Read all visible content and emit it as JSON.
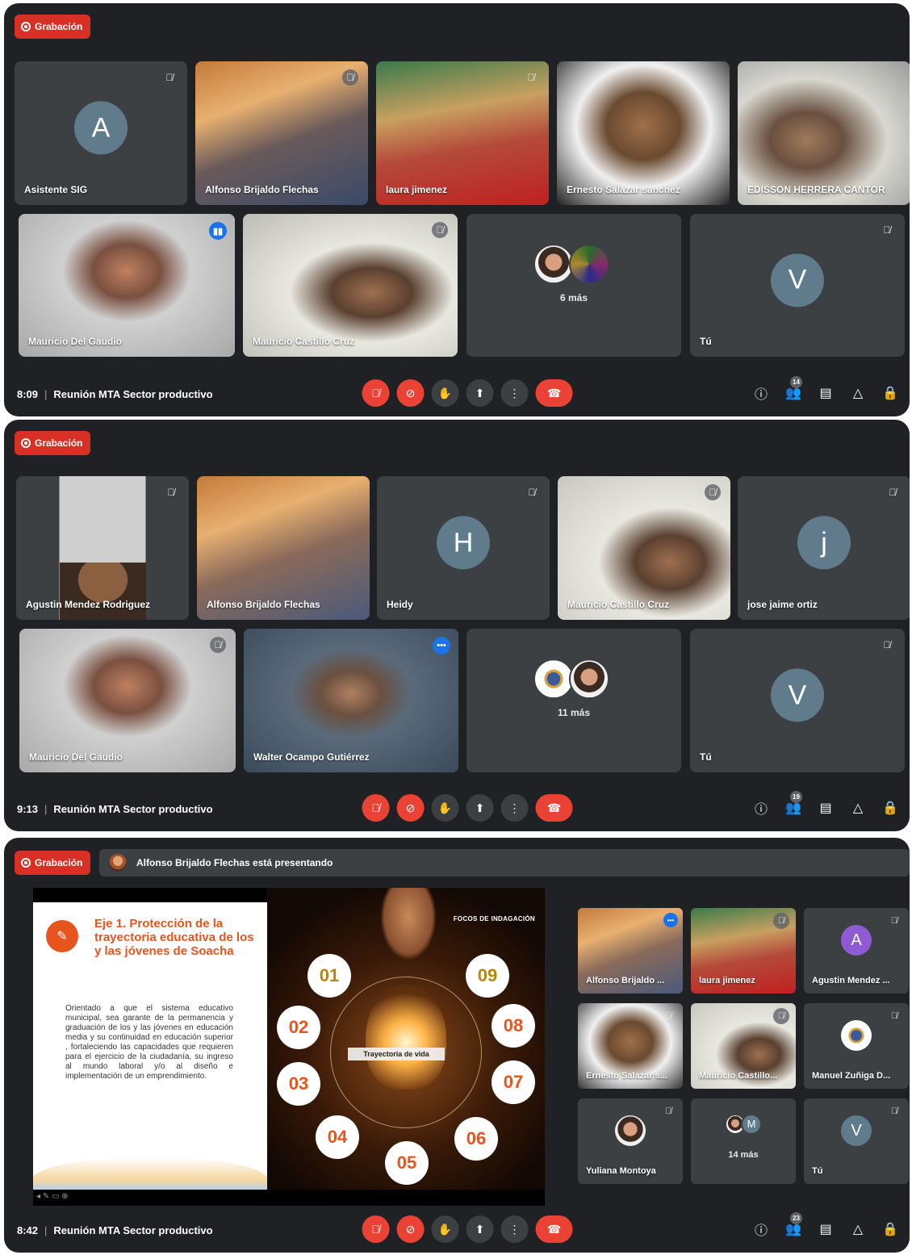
{
  "recording_label": "Grabación",
  "screens": [
    {
      "time": "8:09",
      "meeting_title": "Reunión MTA Sector productivo",
      "participant_count": "14",
      "tiles": [
        {
          "name": "Asistente SIG",
          "avatar": "A"
        },
        {
          "name": "Alfonso Brijaldo Flechas"
        },
        {
          "name": "laura jimenez"
        },
        {
          "name": "Ernesto Salazar sanchez"
        },
        {
          "name": "EDISSON HERRERA CANTOR"
        },
        {
          "name": "Mauricio Del Gaudio"
        },
        {
          "name": "Mauricio Castillo Cruz"
        },
        {
          "more": "6 más"
        },
        {
          "name": "Tú",
          "avatar": "V"
        }
      ]
    },
    {
      "time": "9:13",
      "meeting_title": "Reunión MTA Sector productivo",
      "participant_count": "19",
      "tiles": [
        {
          "name": "Agustin Mendez Rodriguez"
        },
        {
          "name": "Alfonso Brijaldo Flechas"
        },
        {
          "name": "Heidy",
          "avatar": "H"
        },
        {
          "name": "Mauricio Castillo Cruz"
        },
        {
          "name": "jose jaime ortiz",
          "avatar": "j"
        },
        {
          "name": "Mauricio Del Gaudio"
        },
        {
          "name": "Walter Ocampo Gutiérrez"
        },
        {
          "more": "11 más"
        },
        {
          "name": "Tú",
          "avatar": "V"
        }
      ]
    },
    {
      "time": "8:42",
      "meeting_title": "Reunión MTA Sector productivo",
      "participant_count": "23",
      "presenting_banner": "Alfonso Brijaldo Flechas está presentando",
      "slide": {
        "heading": "Eje 1. Protección de la trayectoria educativa de los y las jóvenes de Soacha",
        "body": "Orientado a que el sistema educativo municipal, sea garante de la permanencia y graduación de los y las jóvenes en educación media y su continuidad en educación superior , fortaleciendo las capacidades que requieren para el ejercicio de la ciudadanía, su ingreso al mundo laboral y/o al diseño e implementación de un emprendimiento.",
        "focos": "FOCOS DE INDAGACIÓN",
        "center": "Trayectoria de vida",
        "numbers": [
          "01",
          "02",
          "03",
          "04",
          "05",
          "06",
          "07",
          "08",
          "09"
        ]
      },
      "side_tiles": [
        {
          "name": "Alfonso Brijaldo ..."
        },
        {
          "name": "laura jimenez"
        },
        {
          "name": "Agustin Mendez ...",
          "avatar": "A"
        },
        {
          "name": "Ernesto Salazar s..."
        },
        {
          "name": "Mauricio Castillo..."
        },
        {
          "name": "Manuel Zuñiga D..."
        },
        {
          "name": "Yuliana Montoya"
        },
        {
          "more": "14 más",
          "avatar": "M"
        },
        {
          "name": "Tú",
          "avatar": "V"
        }
      ]
    }
  ],
  "colors": {
    "meet_bg": "#202124",
    "tile_bg": "#3c4043",
    "red": "#ea4335",
    "active_outline": "#8ab4f8",
    "slide_accent": "#e8541e"
  }
}
